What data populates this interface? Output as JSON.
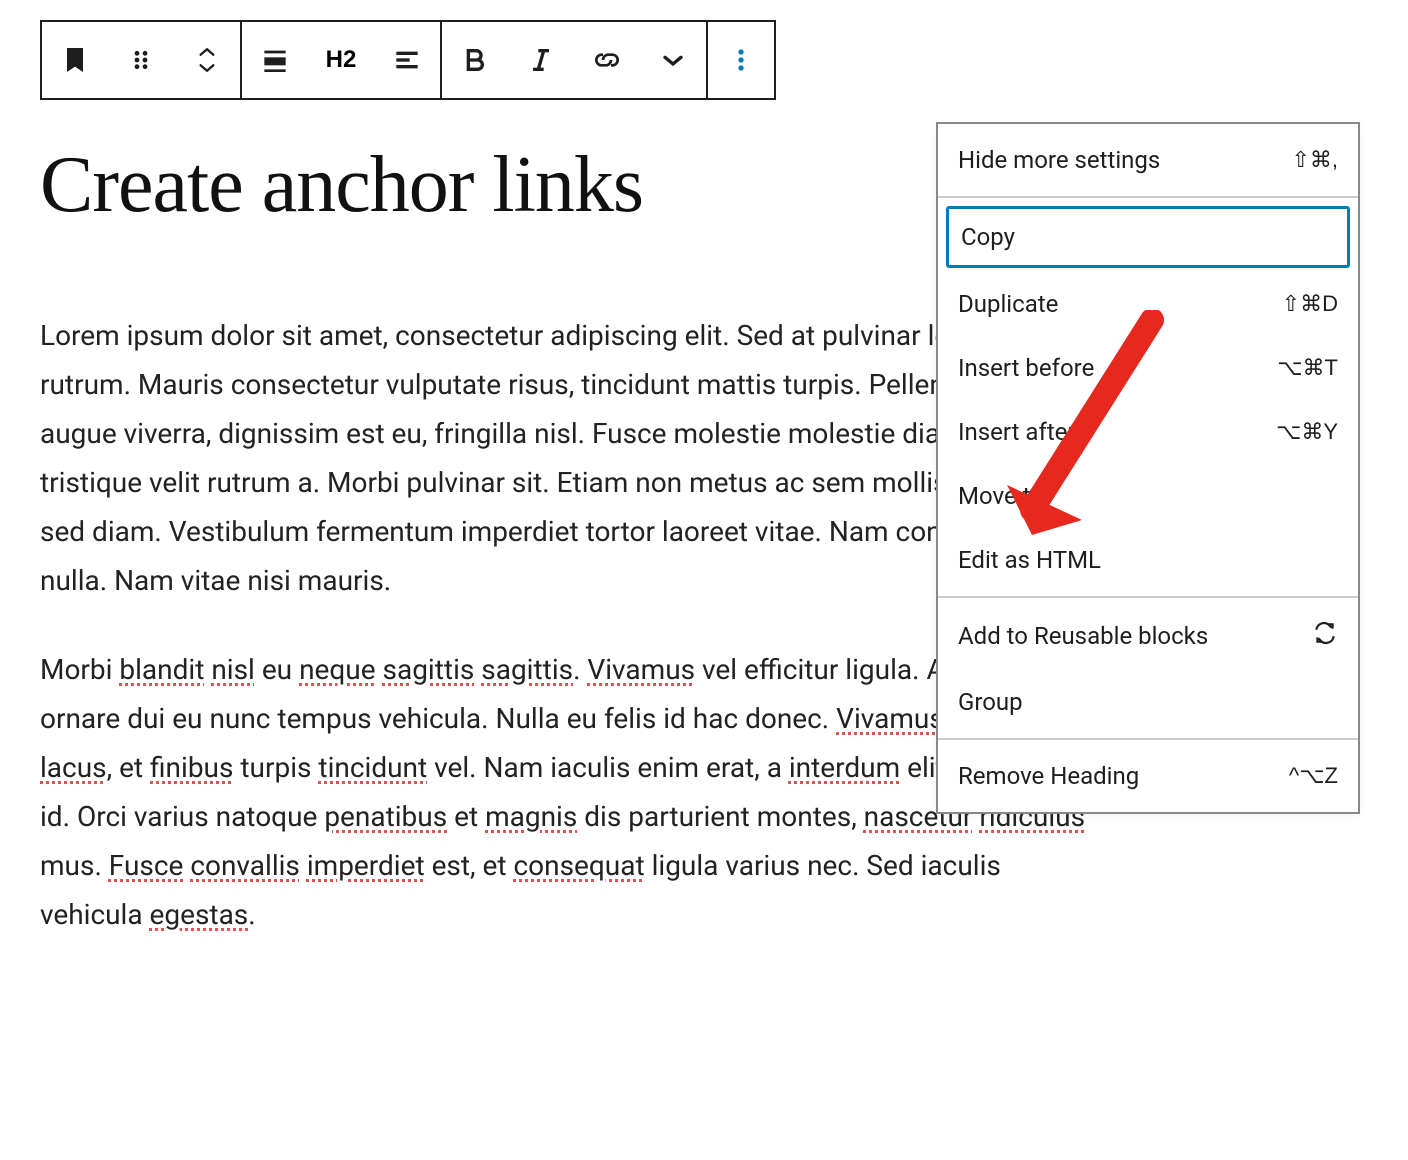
{
  "toolbar": {
    "heading_level": "H2"
  },
  "title": "Create anchor links",
  "paragraphs": [
    "Lorem ipsum dolor sit amet, consectetur adipiscing elit. Sed at pulvinar leo, quis rutrum. Mauris consectetur vulputate risus, tincidunt mattis turpis. Pellentesque non augue viverra, dignissim est eu, fringilla nisl. Fusce molestie molestie diam, sed tristique velit rutrum a. Morbi pulvinar sit. Etiam non metus ac sem mollis iaculis vel sed diam. Vestibulum fermentum imperdiet tortor laoreet vitae. Nam congue lobortis nulla. Nam vitae nisi mauris.",
    "Morbi blandit nisl eu neque sagittis sagittis. Vivamus vel efficitur ligula. Aliquam ornare dui eu nunc tempus vehicula. Nulla eu felis id hac donec. Vivamus fringilla leo lacus, et finibus turpis tincidunt vel. Nam iaculis enim erat, a interdum elit maximus id. Orci varius natoque penatibus et magnis dis parturient montes, nascetur ridiculus mus. Fusce convallis imperdiet est, et consequat ligula varius nec. Sed iaculis vehicula egestas."
  ],
  "menu": {
    "sections": [
      {
        "items": [
          {
            "label": "Hide more settings",
            "shortcut": "⇧⌘,"
          }
        ]
      },
      {
        "items": [
          {
            "label": "Copy",
            "highlighted": true
          },
          {
            "label": "Duplicate",
            "shortcut": "⇧⌘D"
          },
          {
            "label": "Insert before",
            "shortcut": "⌥⌘T"
          },
          {
            "label": "Insert after",
            "shortcut": "⌥⌘Y"
          },
          {
            "label": "Move to"
          },
          {
            "label": "Edit as HTML"
          }
        ]
      },
      {
        "items": [
          {
            "label": "Add to Reusable blocks",
            "icon": "convert"
          },
          {
            "label": "Group"
          }
        ]
      },
      {
        "items": [
          {
            "label": "Remove Heading",
            "shortcut": "^⌥Z"
          }
        ]
      }
    ]
  },
  "spell_errors": [
    "blandit",
    "nisl",
    "neque",
    "sagittis",
    "sagittis",
    "Vivamus",
    "lacus",
    "finibus",
    "tincidunt",
    "interdum",
    "penatibus",
    "magnis",
    "nascetur",
    "ridiculus",
    "Fusce",
    "convallis",
    "imperdiet",
    "consequat",
    "egestas"
  ]
}
